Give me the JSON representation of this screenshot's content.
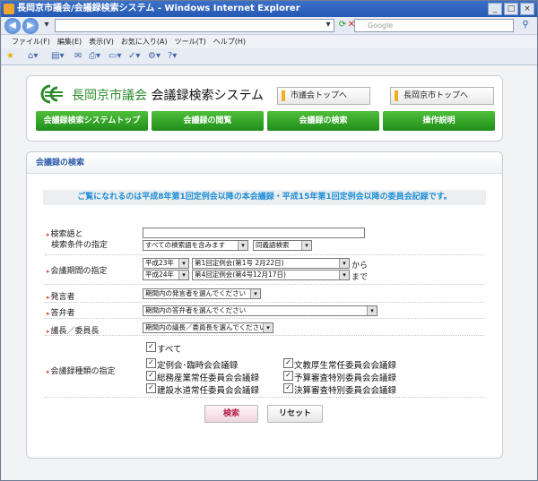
{
  "window": {
    "title": "長岡京市議会/会議録検索システム - Windows Internet Explorer",
    "url": "",
    "search_placeholder": "Google"
  },
  "menu": [
    "ファイル(F)",
    "編集(E)",
    "表示(V)",
    "お気に入り(A)",
    "ツール(T)",
    "ヘルプ(H)"
  ],
  "site": {
    "title_green": "長岡京市議会",
    "title_main": "会議録検索システム",
    "top_links": [
      "市議会トップへ",
      "長岡京市トップへ"
    ],
    "nav": [
      "会議録検索システムトップ",
      "会議録の閲覧",
      "会議録の検索",
      "操作説明"
    ]
  },
  "panel": {
    "heading": "会議録の検索",
    "notice": "ご覧になれるのは平成8年第1回定例会以降の本会議録・平成15年第1回定例会以降の委員会記録です。"
  },
  "form": {
    "keyword_label_1": "検索語と",
    "keyword_label_2": "検索条件の指定",
    "keyword_value": "",
    "keyword_mode": "すべての検索語を含みます",
    "synonym": "同義語検索",
    "period_label": "会議期間の指定",
    "from_year": "平成23年",
    "from_session": "第1回定例会(第1号 2月22日)",
    "from_suffix": "から",
    "to_year": "平成24年",
    "to_session": "第4回定例会(第4号12月17日)",
    "to_suffix": "まで",
    "speaker_label": "発言者",
    "speaker_value": "期間内の発言者を選んでください",
    "answerer_label": "答弁者",
    "answerer_value": "期間内の答弁者を選んでください",
    "chair_label": "議長／委員長",
    "chair_value": "期間内の議長／委員長を選んでください",
    "types_label": "会議録種類の指定",
    "all": "すべて",
    "types_left": [
      "定例会･臨時会会議録",
      "総務産業常任委員会会議録",
      "建設水道常任委員会会議録"
    ],
    "types_right": [
      "文教厚生常任委員会会議録",
      "予算審査特別委員会会議録",
      "決算審査特別委員会会議録"
    ],
    "search_button": "検索",
    "reset_button": "リセット"
  }
}
